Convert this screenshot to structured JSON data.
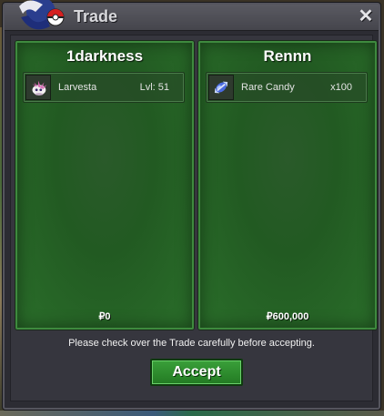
{
  "window": {
    "title": "Trade",
    "close_symbol": "✕"
  },
  "trade": {
    "left": {
      "player_name": "1darkness",
      "items": [
        {
          "icon": "larvesta-icon",
          "name": "Larvesta",
          "extra": "Lvl: 51"
        }
      ],
      "money": "₽0"
    },
    "right": {
      "player_name": "Rennn",
      "items": [
        {
          "icon": "rare-candy-icon",
          "name": "Rare Candy",
          "extra": "x100"
        }
      ],
      "money": "₽600,000"
    }
  },
  "notice": "Please check over the Trade carefully before accepting.",
  "buttons": {
    "accept_label": "Accept"
  },
  "colors": {
    "panel_green": "#225a22",
    "panel_border": "#3e8a3e",
    "accept_green": "#2e8e2e",
    "window_bg": "#2c2c33",
    "titlebar": "#4f4f56"
  }
}
